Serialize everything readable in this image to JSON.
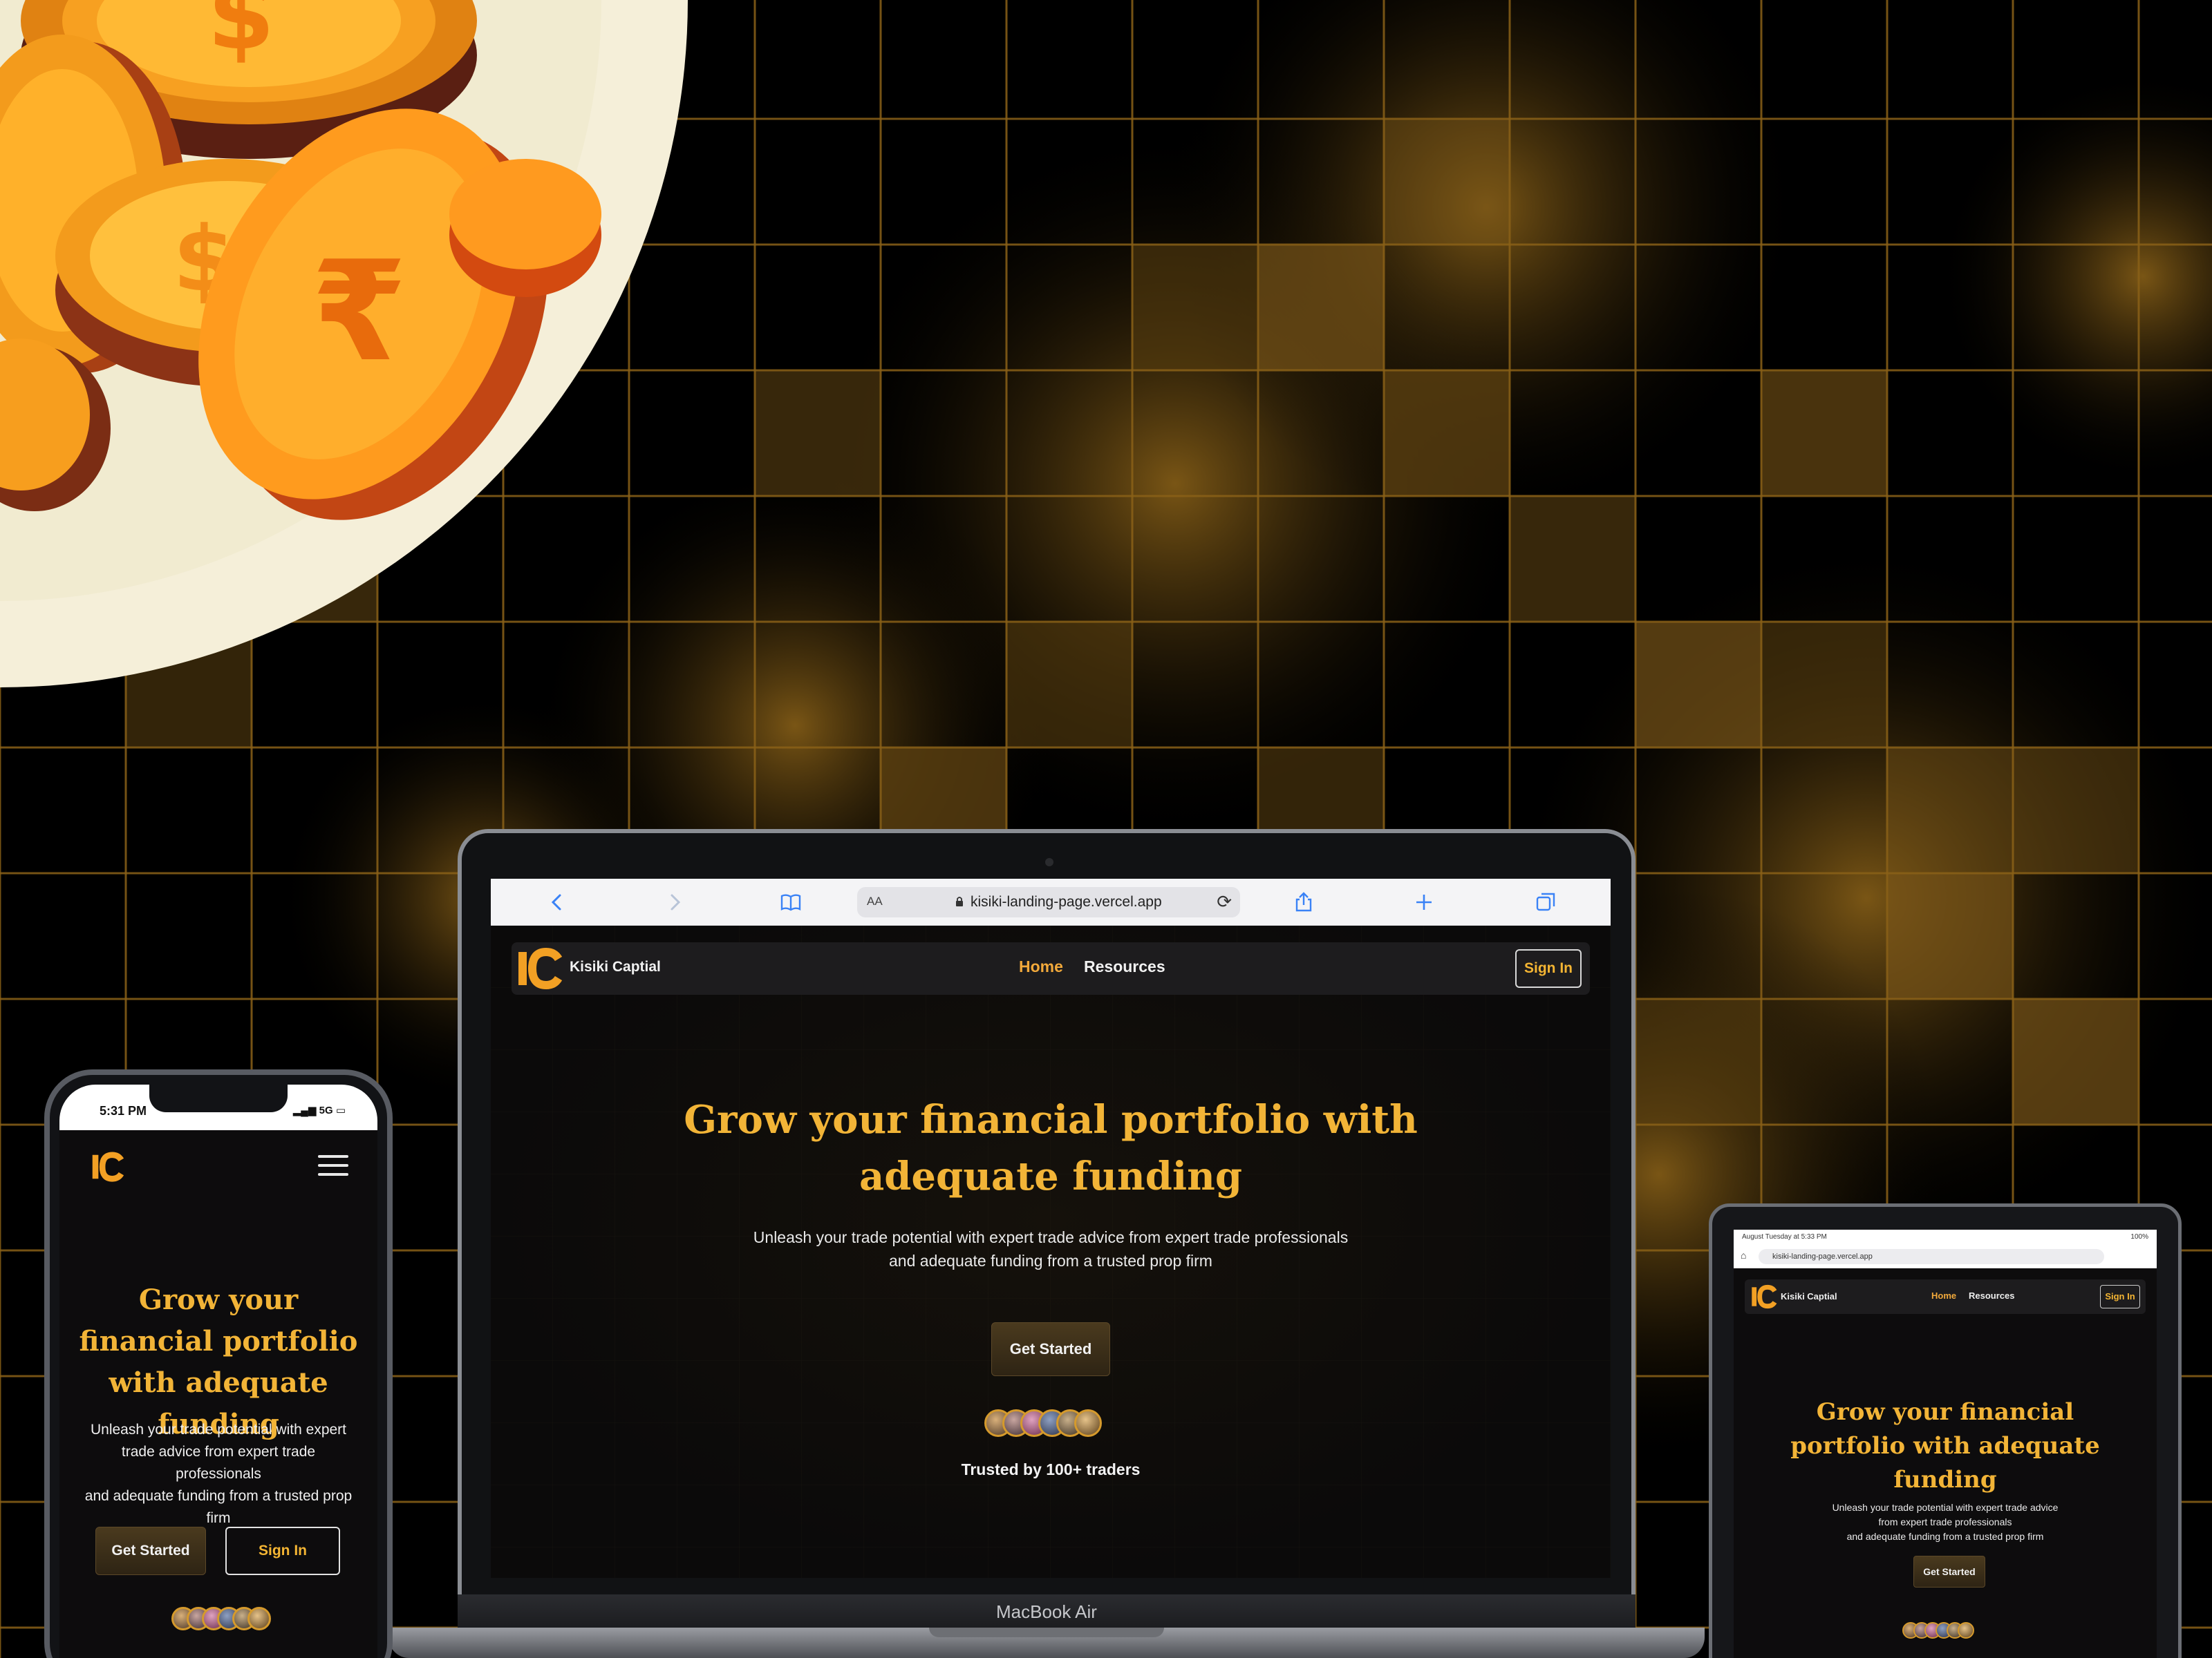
{
  "browser": {
    "aa_label": "AA",
    "url": "kisiki-landing-page.vercel.app"
  },
  "site": {
    "brand": "Kisiki Captial",
    "nav": {
      "home": "Home",
      "resources": "Resources",
      "sign_in": "Sign In"
    },
    "hero": {
      "title": "Grow your financial portfolio with adequate funding",
      "subtitle": "Unleash your trade potential with expert trade advice from expert trade professionals\nand adequate funding from a trusted prop firm",
      "cta": "Get Started",
      "trusted": "Trusted by 100+ traders"
    },
    "brand_color": "#f2b437",
    "nav_active_color": "#f2a93b"
  },
  "devices": {
    "laptop_label": "MacBook Air",
    "phone": {
      "time": "5:31 PM",
      "signal": "5G",
      "subtitle": "Unleash your trade potential with expert\ntrade advice from expert trade\nprofessionals\nand adequate funding from a trusted prop\nfirm",
      "sign_in": "Sign In"
    },
    "tablet": {
      "status": "August Tuesday at 5:33 PM",
      "battery": "100%",
      "url": "kisiki-landing-page.vercel.app",
      "subtitle": "Unleash your trade potential with expert trade advice\nfrom expert trade professionals\nand adequate funding from a trusted prop firm"
    }
  },
  "icons": [
    "back-icon",
    "forward-icon",
    "bookmarks-icon",
    "lock-icon",
    "reload-icon",
    "share-icon",
    "new-tab-icon",
    "tabs-icon",
    "hamburger-menu-icon",
    "home-icon"
  ]
}
